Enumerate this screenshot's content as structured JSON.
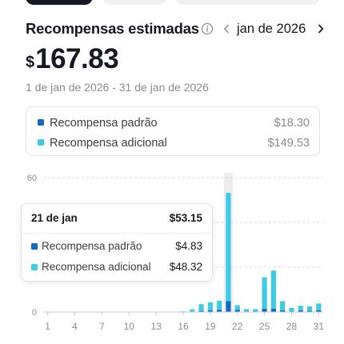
{
  "header": {
    "title": "Recompensas estimadas",
    "month": "jan de 2026"
  },
  "summary": {
    "currency": "$",
    "amount": "167.83",
    "date_range": "1 de jan de 2026 - 31 de jan de 2026"
  },
  "breakdown": [
    {
      "label": "Recompensa padrão",
      "value": "$18.30",
      "color": "#1668c7"
    },
    {
      "label": "Recompensa adicional",
      "value": "$149.53",
      "color": "#3ecbe4"
    }
  ],
  "tooltip": {
    "date": "21 de jan",
    "total": "$53.15",
    "rows": [
      {
        "label": "Recompensa padrão",
        "value": "$4.83"
      },
      {
        "label": "Recompensa adicional",
        "value": "$48.32"
      }
    ]
  },
  "colors": {
    "standard": "#1668c7",
    "additional": "#3ecbe4",
    "grid": "#d9d9dc",
    "highlight": "#ececef"
  },
  "icons": [
    "info-icon",
    "chevron-left-icon",
    "chevron-right-icon"
  ],
  "chart_data": {
    "type": "bar",
    "stacked": true,
    "ylim": [
      0,
      60
    ],
    "y_ticks": [
      0,
      60
    ],
    "x_ticks": [
      "1",
      "4",
      "7",
      "10",
      "13",
      "16",
      "19",
      "22",
      "25",
      "28",
      "31"
    ],
    "categories": [
      "1",
      "2",
      "3",
      "4",
      "5",
      "6",
      "7",
      "8",
      "9",
      "10",
      "11",
      "12",
      "13",
      "14",
      "15",
      "16",
      "17",
      "18",
      "19",
      "20",
      "21",
      "22",
      "23",
      "24",
      "25",
      "26",
      "27",
      "28",
      "29",
      "30",
      "31"
    ],
    "highlighted_category": "21",
    "series": [
      {
        "name": "Recompensa padrão",
        "values": [
          0,
          0,
          0,
          0,
          0,
          0,
          0,
          0,
          0,
          0,
          0,
          0,
          0,
          0,
          0,
          0,
          0.2,
          0.5,
          0.8,
          1.0,
          4.83,
          1.0,
          0.3,
          0.3,
          1.5,
          1.5,
          0.8,
          0.3,
          0.8,
          0.5,
          0.8
        ]
      },
      {
        "name": "Recompensa adicional",
        "values": [
          0,
          0,
          0,
          0,
          0,
          0,
          0,
          0,
          0,
          0,
          0,
          0,
          0,
          0,
          0,
          0.3,
          1.0,
          3.0,
          3.5,
          4.0,
          48.32,
          2.0,
          1.0,
          1.0,
          14.0,
          17.0,
          4.0,
          1.5,
          2.0,
          2.0,
          3.0
        ]
      }
    ]
  }
}
